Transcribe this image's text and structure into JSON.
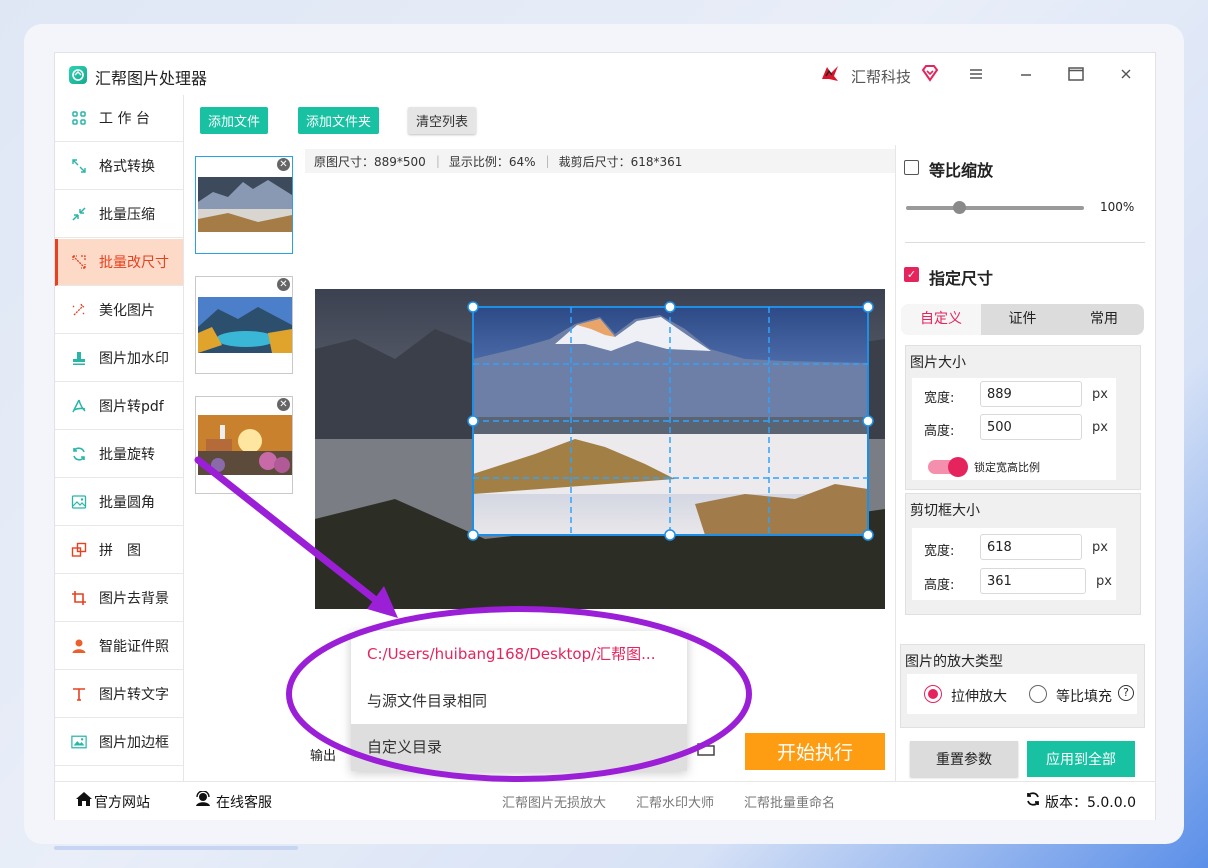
{
  "app": {
    "title": "汇帮图片处理器",
    "brand": "汇帮科技"
  },
  "window_controls": {
    "menu": "menu-icon",
    "minimize": "minimize-icon",
    "maximize": "maximize-icon",
    "close": "close-icon"
  },
  "sidebar": {
    "items": [
      {
        "label": "工 作 台",
        "icon": "grid-icon"
      },
      {
        "label": "格式转换",
        "icon": "convert-icon"
      },
      {
        "label": "批量压缩",
        "icon": "compress-icon"
      },
      {
        "label": "批量改尺寸",
        "icon": "resize-icon"
      },
      {
        "label": "美化图片",
        "icon": "beautify-icon"
      },
      {
        "label": "图片加水印",
        "icon": "watermark-icon"
      },
      {
        "label": "图片转pdf",
        "icon": "pdf-icon"
      },
      {
        "label": "批量旋转",
        "icon": "rotate-icon"
      },
      {
        "label": "批量圆角",
        "icon": "rounded-corner-icon"
      },
      {
        "label": "拼　图",
        "icon": "collage-icon"
      },
      {
        "label": "图片去背景",
        "icon": "crop-icon"
      },
      {
        "label": "智能证件照",
        "icon": "person-icon"
      },
      {
        "label": "图片转文字",
        "icon": "text-icon"
      },
      {
        "label": "图片加边框",
        "icon": "frame-icon"
      }
    ]
  },
  "toolbar": {
    "add_file": "添加文件",
    "add_folder": "添加文件夹",
    "clear_list": "清空列表"
  },
  "info": {
    "original_size": "原图尺寸：889*500",
    "display_ratio": "显示比例：64%",
    "cropped_size": "裁剪后尺寸：618*361"
  },
  "right": {
    "proportional_label": "等比缩放",
    "zoom_percent": "100%",
    "zoom_value": 0.3,
    "specify_size_label": "指定尺寸",
    "tabs": [
      "自定义",
      "证件",
      "常用"
    ],
    "image_size_title": "图片大小",
    "width_label": "宽度:",
    "height_label": "高度:",
    "width_value": "889",
    "height_value": "500",
    "unit": "px",
    "lock_label": "锁定宽高比例",
    "crop_size_title": "剪切框大小",
    "crop_width_value": "618",
    "crop_height_value": "361",
    "enlarge_type_title": "图片的放大类型",
    "option_stretch": "拉伸放大",
    "option_fill": "等比填充",
    "reset_label": "重置参数",
    "apply_label": "应用到全部"
  },
  "output": {
    "label": "输出",
    "start_label": "开始执行"
  },
  "dropdown": {
    "items": [
      "C:/Users/huibang168/Desktop/汇帮图...",
      "与源文件目录相同",
      "自定义目录"
    ]
  },
  "footer": {
    "website": "官方网站",
    "service": "在线客服",
    "link1": "汇帮图片无损放大",
    "link2": "汇帮水印大师",
    "link3": "汇帮批量重命名",
    "version": "版本：5.0.0.0"
  },
  "colors": {
    "accent": "#e5245d",
    "teal": "#17c1a2",
    "orange": "#ff9d12",
    "annotation": "#9b1fd6"
  }
}
